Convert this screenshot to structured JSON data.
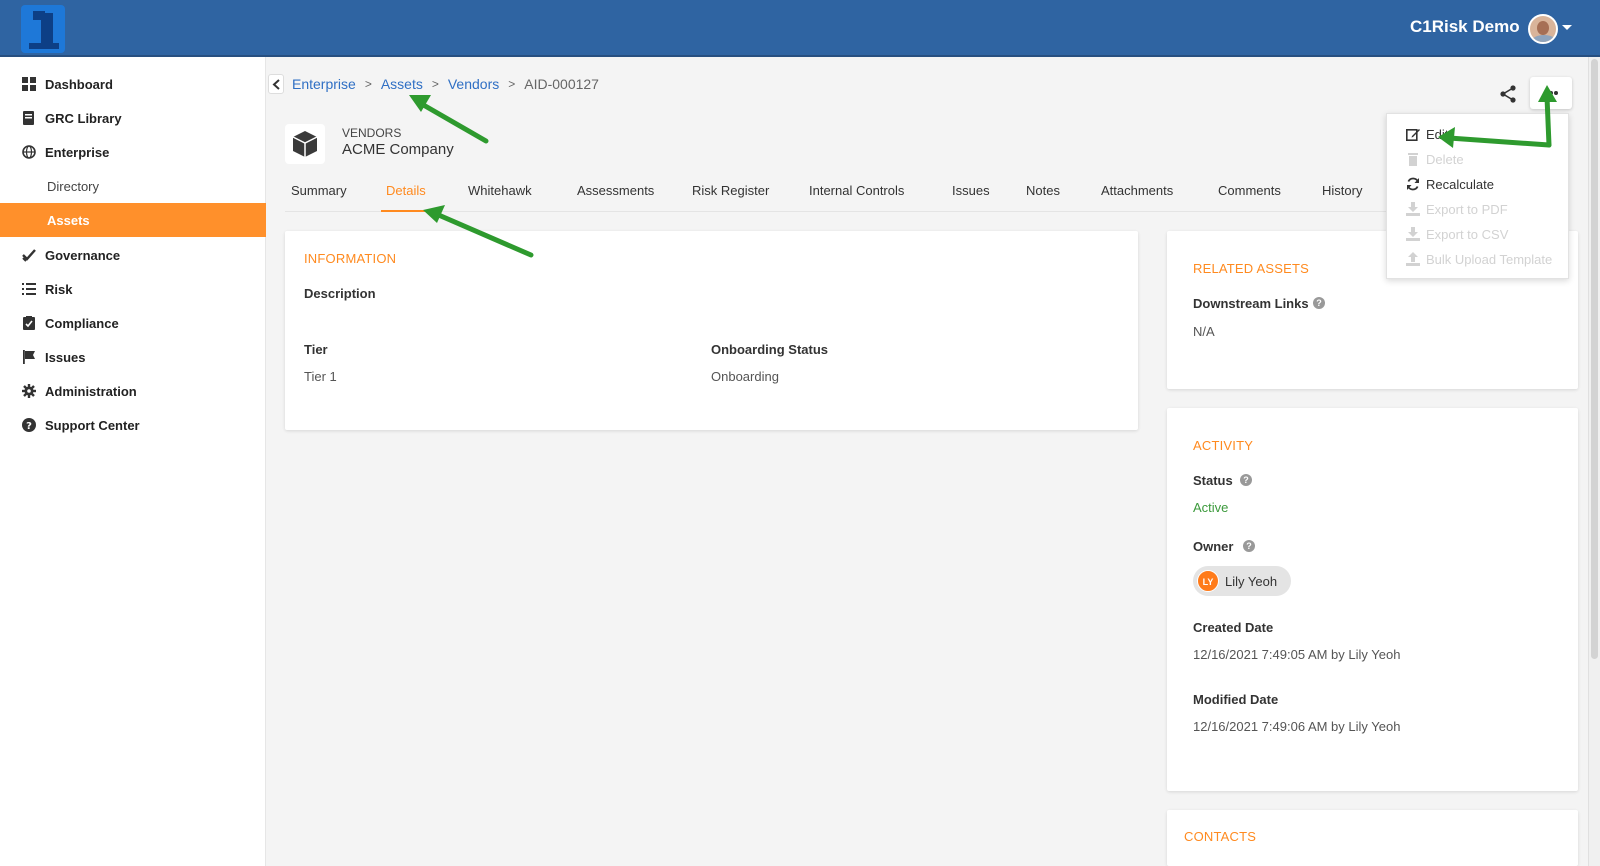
{
  "header": {
    "user_name": "C1Risk Demo"
  },
  "sidebar": {
    "items": [
      {
        "label": "Dashboard",
        "icon": "dashboard-icon"
      },
      {
        "label": "GRC Library",
        "icon": "book-icon"
      },
      {
        "label": "Enterprise",
        "icon": "globe-icon"
      },
      {
        "label": "Directory",
        "sub": true
      },
      {
        "label": "Assets",
        "sub": true,
        "active": true
      },
      {
        "label": "Governance",
        "icon": "check-icon"
      },
      {
        "label": "Risk",
        "icon": "list-icon"
      },
      {
        "label": "Compliance",
        "icon": "clipboard-icon"
      },
      {
        "label": "Issues",
        "icon": "flag-icon"
      },
      {
        "label": "Administration",
        "icon": "gear-icon"
      },
      {
        "label": "Support Center",
        "icon": "question-icon"
      }
    ]
  },
  "breadcrumb": {
    "items": [
      "Enterprise",
      "Assets",
      "Vendors"
    ],
    "separator": ">",
    "current": "AID-000127"
  },
  "record": {
    "type": "VENDORS",
    "name": "ACME Company"
  },
  "tabs": [
    {
      "label": "Summary"
    },
    {
      "label": "Details",
      "active": true
    },
    {
      "label": "Whitehawk"
    },
    {
      "label": "Assessments"
    },
    {
      "label": "Risk Register"
    },
    {
      "label": "Internal Controls"
    },
    {
      "label": "Issues"
    },
    {
      "label": "Notes"
    },
    {
      "label": "Attachments"
    },
    {
      "label": "Comments"
    },
    {
      "label": "History"
    }
  ],
  "information": {
    "title": "INFORMATION",
    "description_label": "Description",
    "tier_label": "Tier",
    "tier_value": "Tier 1",
    "onboarding_label": "Onboarding Status",
    "onboarding_value": "Onboarding"
  },
  "related_assets": {
    "title": "RELATED ASSETS",
    "downstream_label": "Downstream Links",
    "downstream_value": "N/A"
  },
  "activity": {
    "title": "ACTIVITY",
    "status_label": "Status",
    "status_value": "Active",
    "owner_label": "Owner",
    "owner_initials": "LY",
    "owner_name": "Lily Yeoh",
    "created_label": "Created Date",
    "created_value": "12/16/2021 7:49:05 AM by Lily Yeoh",
    "modified_label": "Modified Date",
    "modified_value": "12/16/2021 7:49:06 AM by Lily Yeoh"
  },
  "contacts": {
    "title": "CONTACTS"
  },
  "menu": {
    "items": [
      {
        "label": "Edit",
        "icon": "edit-icon",
        "disabled": false
      },
      {
        "label": "Delete",
        "icon": "trash-icon",
        "disabled": true
      },
      {
        "label": "Recalculate",
        "icon": "refresh-icon",
        "disabled": false
      },
      {
        "label": "Export to PDF",
        "icon": "download-icon",
        "disabled": true
      },
      {
        "label": "Export to CSV",
        "icon": "download-icon",
        "disabled": true
      },
      {
        "label": "Bulk Upload Template",
        "icon": "upload-icon",
        "disabled": true
      }
    ]
  },
  "colors": {
    "header": "#2f64a2",
    "accent": "#ff8a1f",
    "link": "#2f6fc4",
    "active_status": "#3c9a3c",
    "annotation_arrow": "#2e9a2e"
  }
}
